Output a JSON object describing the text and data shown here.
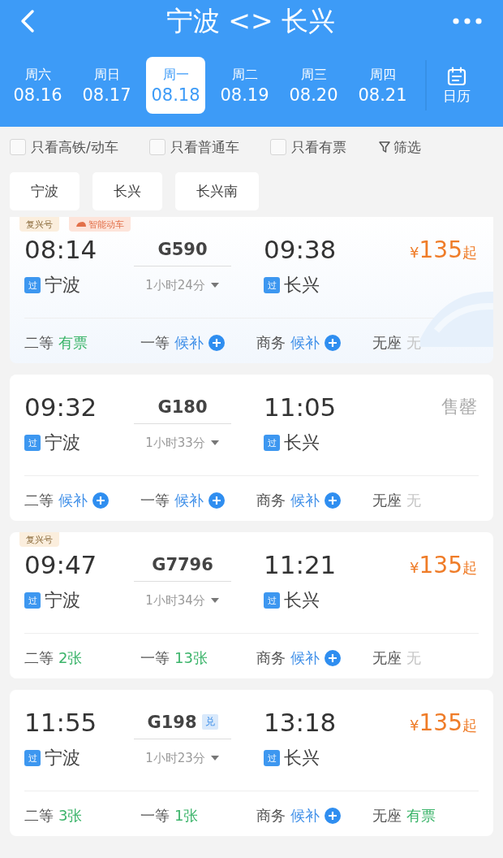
{
  "header": {
    "title": "宁波 <> 长兴"
  },
  "dates": [
    {
      "weekday": "周六",
      "date": "08.16",
      "selected": false
    },
    {
      "weekday": "周日",
      "date": "08.17",
      "selected": false
    },
    {
      "weekday": "周一",
      "date": "08.18",
      "selected": true
    },
    {
      "weekday": "周二",
      "date": "08.19",
      "selected": false
    },
    {
      "weekday": "周三",
      "date": "08.20",
      "selected": false
    },
    {
      "weekday": "周四",
      "date": "08.21",
      "selected": false
    }
  ],
  "calendar_label": "日历",
  "filters": [
    {
      "label": "只看高铁/动车",
      "checked": false
    },
    {
      "label": "只看普通车",
      "checked": false
    },
    {
      "label": "只看有票",
      "checked": false
    }
  ],
  "filter_button": "筛选",
  "stations": [
    "宁波",
    "长兴",
    "长兴南"
  ],
  "trains": [
    {
      "highlighted": true,
      "tags": [
        {
          "label": "复兴号",
          "kind": "fuxing"
        },
        {
          "label": "智能动车",
          "kind": "smart"
        }
      ],
      "depart_time": "08:14",
      "train_no": "G590",
      "duration": "1小时24分",
      "arrive_time": "09:38",
      "from_mark": "过",
      "from_station": "宁波",
      "to_mark": "过",
      "to_station": "长兴",
      "price": {
        "kind": "price",
        "currency": "¥",
        "amount": "135",
        "suffix": "起"
      },
      "seats": [
        {
          "class": "二等",
          "status": "有票",
          "kind": "available"
        },
        {
          "class": "一等",
          "status": "候补",
          "kind": "waitlist"
        },
        {
          "class": "商务",
          "status": "候补",
          "kind": "waitlist"
        },
        {
          "class": "无座",
          "status": "无",
          "kind": "none"
        }
      ]
    },
    {
      "highlighted": false,
      "depart_time": "09:32",
      "train_no": "G180",
      "duration": "1小时33分",
      "arrive_time": "11:05",
      "from_mark": "过",
      "from_station": "宁波",
      "to_mark": "过",
      "to_station": "长兴",
      "price": {
        "kind": "sold_out",
        "text": "售罄"
      },
      "seats": [
        {
          "class": "二等",
          "status": "候补",
          "kind": "waitlist"
        },
        {
          "class": "一等",
          "status": "候补",
          "kind": "waitlist"
        },
        {
          "class": "商务",
          "status": "候补",
          "kind": "waitlist"
        },
        {
          "class": "无座",
          "status": "无",
          "kind": "none"
        }
      ]
    },
    {
      "highlighted": false,
      "tags": [
        {
          "label": "复兴号",
          "kind": "fuxing"
        }
      ],
      "depart_time": "09:47",
      "train_no": "G7796",
      "duration": "1小时34分",
      "arrive_time": "11:21",
      "from_mark": "过",
      "from_station": "宁波",
      "to_mark": "过",
      "to_station": "长兴",
      "price": {
        "kind": "price",
        "currency": "¥",
        "amount": "135",
        "suffix": "起"
      },
      "seats": [
        {
          "class": "二等",
          "status": "2张",
          "kind": "available"
        },
        {
          "class": "一等",
          "status": "13张",
          "kind": "available"
        },
        {
          "class": "商务",
          "status": "候补",
          "kind": "waitlist"
        },
        {
          "class": "无座",
          "status": "无",
          "kind": "none"
        }
      ]
    },
    {
      "highlighted": false,
      "depart_time": "11:55",
      "train_no": "G198",
      "exchange_badge": "兑",
      "duration": "1小时23分",
      "arrive_time": "13:18",
      "from_mark": "过",
      "from_station": "宁波",
      "to_mark": "过",
      "to_station": "长兴",
      "price": {
        "kind": "price",
        "currency": "¥",
        "amount": "135",
        "suffix": "起"
      },
      "seats": [
        {
          "class": "二等",
          "status": "3张",
          "kind": "available"
        },
        {
          "class": "一等",
          "status": "1张",
          "kind": "available"
        },
        {
          "class": "商务",
          "status": "候补",
          "kind": "waitlist"
        },
        {
          "class": "无座",
          "status": "有票",
          "kind": "available"
        }
      ]
    }
  ]
}
